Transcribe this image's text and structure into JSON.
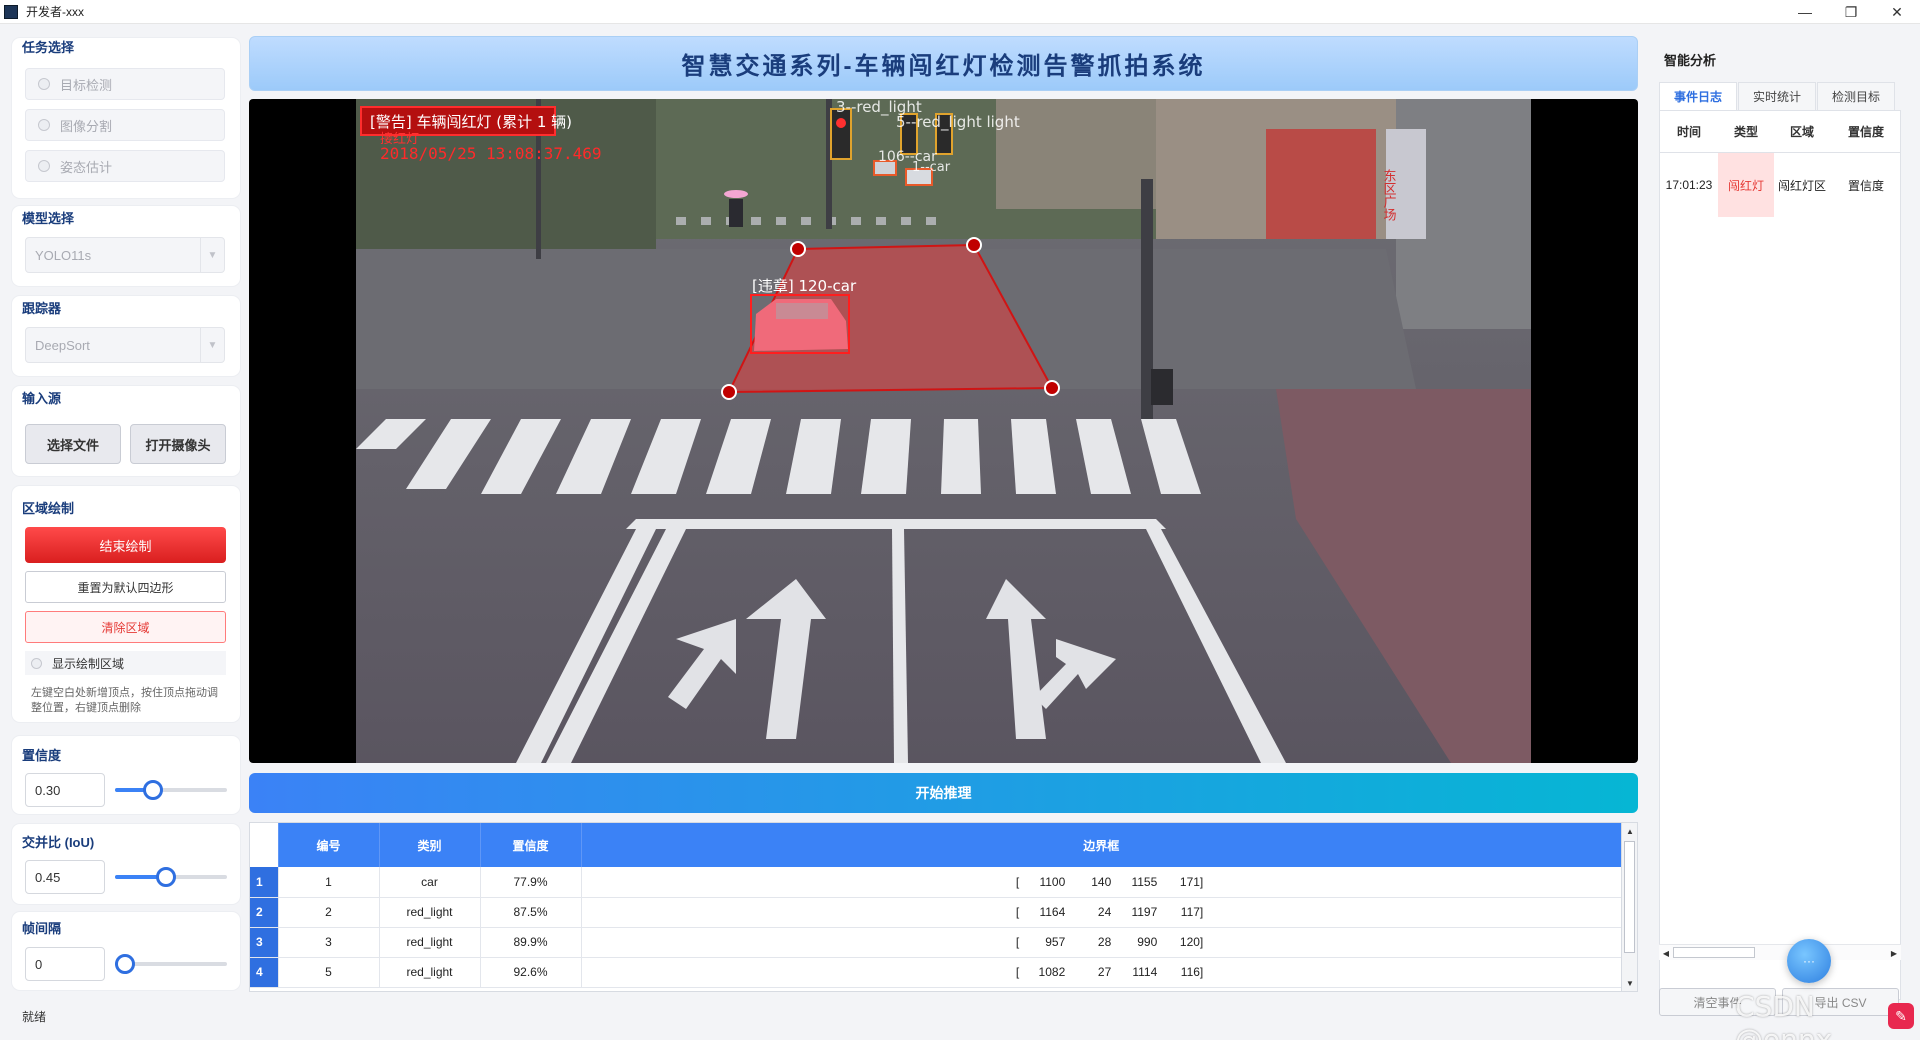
{
  "window": {
    "title": "开发者-xxx",
    "minimize": "—",
    "maximize": "❐",
    "close": "✕"
  },
  "left": {
    "task": {
      "title": "任务选择",
      "options": [
        "目标检测",
        "图像分割",
        "姿态估计"
      ]
    },
    "model": {
      "title": "模型选择",
      "value": "YOLO11s"
    },
    "tracker": {
      "title": "跟踪器",
      "value": "DeepSort"
    },
    "input": {
      "title": "输入源",
      "file_button": "选择文件",
      "camera_button": "打开摄像头"
    },
    "region": {
      "title": "区域绘制",
      "end_button": "结束绘制",
      "reset_button": "重置为默认四边形",
      "clear_button": "清除区域",
      "show_checkbox": "显示绘制区域",
      "hint": "左键空白处新增顶点，按住顶点拖动调整位置，右键顶点删除"
    },
    "conf": {
      "title": "置信度",
      "value": "0.30",
      "level": 0.3
    },
    "iou": {
      "title": "交并比 (IoU)",
      "value": "0.45",
      "level": 0.45
    },
    "interval": {
      "title": "帧间隔",
      "value": "0",
      "level": 0.0
    }
  },
  "center": {
    "banner": "智慧交通系列-车辆闯红灯检测告警抓拍系统",
    "video": {
      "alert": "[警告] 车辆闯红灯 (累计 1 辆)",
      "overlay_text": "接红灯",
      "timestamp": "2018/05/25 13:08:37.469",
      "labels": {
        "violation": "[违章] 120-car",
        "light3": "3--red_light",
        "light5": "5--red_light light",
        "car106": "106--car",
        "car_small": "1--car"
      },
      "shop_sign": "东区广场"
    },
    "start_button": "开始推理",
    "table": {
      "headers": [
        "编号",
        "类别",
        "置信度",
        "边界框"
      ],
      "rows": [
        {
          "n": "1",
          "id": "1",
          "cls": "car",
          "conf": "77.9%",
          "bbox": [
            "[",
            "1100",
            "140",
            "1155",
            "171]"
          ]
        },
        {
          "n": "2",
          "id": "2",
          "cls": "red_light",
          "conf": "87.5%",
          "bbox": [
            "[",
            "1164",
            "24",
            "1197",
            "117]"
          ]
        },
        {
          "n": "3",
          "id": "3",
          "cls": "red_light",
          "conf": "89.9%",
          "bbox": [
            "[",
            "957",
            "28",
            "990",
            "120]"
          ]
        },
        {
          "n": "4",
          "id": "5",
          "cls": "red_light",
          "conf": "92.6%",
          "bbox": [
            "[",
            "1082",
            "27",
            "1114",
            "116]"
          ]
        }
      ]
    }
  },
  "status": "就绪",
  "right": {
    "title": "智能分析",
    "tabs": [
      "事件日志",
      "实时统计",
      "检测目标"
    ],
    "log_headers": [
      "时间",
      "类型",
      "区域",
      "置信度"
    ],
    "log_rows": [
      {
        "time": "17:01:23",
        "type": "闯红灯",
        "area": "闯红灯区",
        "conf": "置信度"
      }
    ],
    "clear_button": "清空事件",
    "export_button": "导出 CSV"
  },
  "watermark": "CSDN @onnx",
  "colors": {
    "accent": "#3b82f6",
    "danger": "#e53935",
    "banner_text": "#1a3d7c"
  }
}
